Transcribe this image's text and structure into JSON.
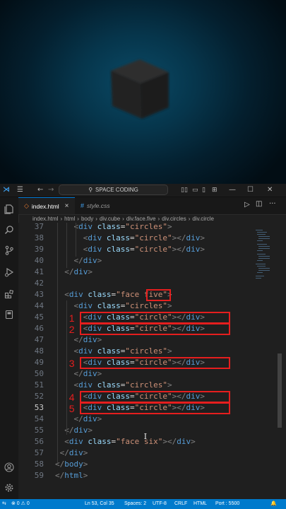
{
  "window": {
    "search_text": "SPACE CODING",
    "controls": [
      "—",
      "☐",
      "✕"
    ]
  },
  "tabs": [
    {
      "label": "index.html",
      "close": "×",
      "active": true
    },
    {
      "label": "style.css",
      "active": false
    }
  ],
  "breadcrumb": [
    "index.html",
    "html",
    "body",
    "div.cube",
    "div.face.five",
    "div.circles",
    "div.circle"
  ],
  "editor": {
    "current_line": 53,
    "lines": [
      {
        "n": 37,
        "indent": 2,
        "kind": "open",
        "cls": "circles"
      },
      {
        "n": 38,
        "indent": 3,
        "kind": "full",
        "cls": "circle"
      },
      {
        "n": 39,
        "indent": 3,
        "kind": "full",
        "cls": "circle"
      },
      {
        "n": 40,
        "indent": 2,
        "kind": "close"
      },
      {
        "n": 41,
        "indent": 1,
        "kind": "close"
      },
      {
        "n": 42,
        "indent": 0,
        "kind": "blank"
      },
      {
        "n": 43,
        "indent": 1,
        "kind": "open",
        "cls": "face five"
      },
      {
        "n": 44,
        "indent": 2,
        "kind": "open",
        "cls": "circles"
      },
      {
        "n": 45,
        "indent": 3,
        "kind": "full",
        "cls": "circle"
      },
      {
        "n": 46,
        "indent": 3,
        "kind": "full",
        "cls": "circle"
      },
      {
        "n": 47,
        "indent": 2,
        "kind": "close"
      },
      {
        "n": 48,
        "indent": 2,
        "kind": "open",
        "cls": "circles"
      },
      {
        "n": 49,
        "indent": 3,
        "kind": "full",
        "cls": "circle"
      },
      {
        "n": 50,
        "indent": 2,
        "kind": "close"
      },
      {
        "n": 51,
        "indent": 2,
        "kind": "open",
        "cls": "circles"
      },
      {
        "n": 52,
        "indent": 3,
        "kind": "full",
        "cls": "circle"
      },
      {
        "n": 53,
        "indent": 3,
        "kind": "full",
        "cls": "circle"
      },
      {
        "n": 54,
        "indent": 2,
        "kind": "close"
      },
      {
        "n": 55,
        "indent": 1,
        "kind": "close"
      },
      {
        "n": 56,
        "indent": 1,
        "kind": "full",
        "cls": "face six"
      },
      {
        "n": 57,
        "indent": 0.5,
        "kind": "close"
      },
      {
        "n": 58,
        "indent": 0,
        "kind": "closetag",
        "tag": "body"
      },
      {
        "n": 59,
        "indent": 0,
        "kind": "closetag",
        "tag": "html"
      }
    ],
    "annotations": [
      "1",
      "2",
      "3",
      "4",
      "5"
    ]
  },
  "status": {
    "remote": "⇆",
    "problems": "⊗ 0 ⚠ 0",
    "position": "Ln 53, Col 35",
    "spaces": "Spaces: 2",
    "encoding": "UTF-8",
    "eol": "CRLF",
    "language": "HTML",
    "port": "Port : 5500",
    "bell": "🔔"
  },
  "colors": {
    "accent": "#007acc",
    "highlight": "#e51e1e",
    "tag": "#569cd6",
    "attr": "#9cdcfe",
    "string": "#ce9178"
  }
}
